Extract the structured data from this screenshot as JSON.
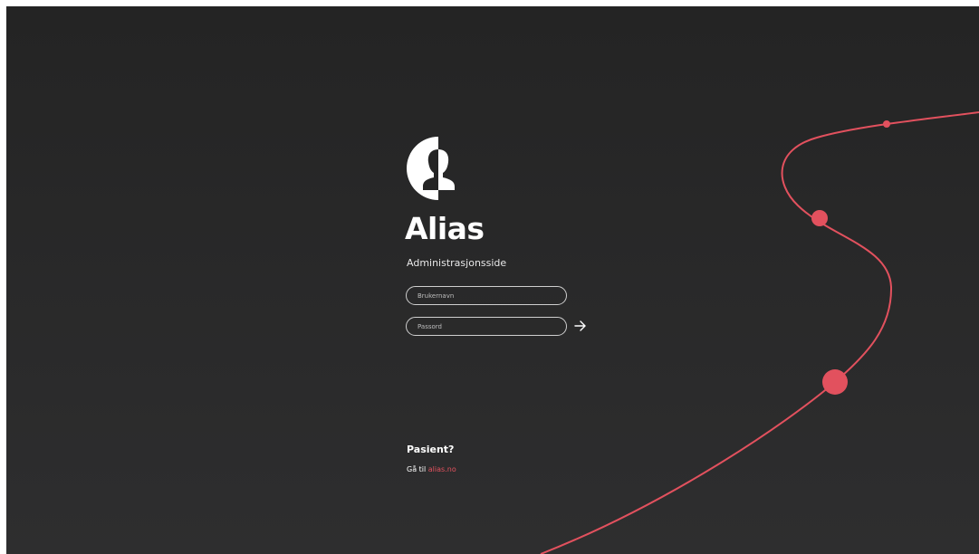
{
  "app": {
    "title": "Alias",
    "subtitle": "Administrasjonsside"
  },
  "login": {
    "username_placeholder": "Brukernavn",
    "password_placeholder": "Passord",
    "username_value": "",
    "password_value": "",
    "submit_icon": "arrow-right-icon"
  },
  "patient": {
    "heading": "Pasient?",
    "prefix": "Gå til",
    "link_text": "alias.no"
  },
  "logo_icon": "person-half-circle-logo",
  "colors": {
    "background_top": "#242424",
    "background_bottom": "#2e2e2f",
    "accent": "#e2515e",
    "text": "#ffffff"
  }
}
